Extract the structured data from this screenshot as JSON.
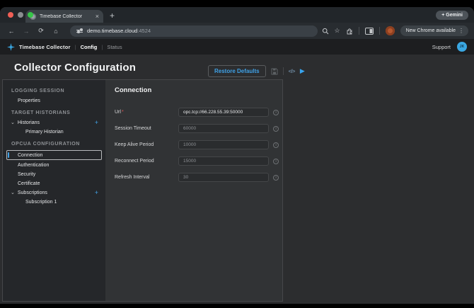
{
  "icons": {
    "back": "←",
    "forward": "→",
    "reload": "⟳",
    "home": "⌂",
    "star": "☆",
    "menu_dots": "⋮",
    "close_tab": "×",
    "new_tab": "+",
    "chevron_down": "⌄",
    "plus": "+",
    "code": "</>",
    "play": "▶",
    "info": "i"
  },
  "colors": {
    "accent_blue": "#41a3e8",
    "required_red": "#e05252",
    "user_avatar_blue": "#3aa7e2",
    "profile_avatar_orange": "#b5582f"
  },
  "browser": {
    "tab_title": "Timebase Collector",
    "gemini_button": "+ Gemini",
    "url_host": "demo.timebase.cloud",
    "url_port": ":4524",
    "new_chrome_label": "New Chrome available"
  },
  "app_header": {
    "brand": "Timebase Collector",
    "nav": [
      {
        "label": "Config",
        "active": true
      },
      {
        "label": "Status",
        "active": false
      }
    ],
    "support": "Support",
    "avatar_initials": "JK"
  },
  "page": {
    "title": "Collector Configuration",
    "restore_defaults_label": "Restore Defaults"
  },
  "sidebar": {
    "sections": [
      {
        "header": "LOGGING SESSION",
        "items": [
          {
            "label": "Properties",
            "type": "item"
          }
        ]
      },
      {
        "header": "TARGET HISTORIANS",
        "items": [
          {
            "label": "Historians",
            "type": "group",
            "expanded": true,
            "addable": true
          },
          {
            "label": "Primary Historian",
            "type": "child"
          }
        ]
      },
      {
        "header": "OPCUA CONFIGURATION",
        "items": [
          {
            "label": "Connection",
            "type": "item",
            "selected": true
          },
          {
            "label": "Authentication",
            "type": "item"
          },
          {
            "label": "Security",
            "type": "item"
          },
          {
            "label": "Certificate",
            "type": "item"
          },
          {
            "label": "Subscriptions",
            "type": "group",
            "expanded": true,
            "addable": true
          },
          {
            "label": "Subscription 1",
            "type": "child"
          }
        ]
      }
    ]
  },
  "form": {
    "title": "Connection",
    "fields": [
      {
        "label": "Url",
        "required": true,
        "value": "opc.tcp://66.228.55.39:50000",
        "muted": false
      },
      {
        "label": "Session Timeout",
        "required": false,
        "value": "60000",
        "muted": true
      },
      {
        "label": "Keep Alive Period",
        "required": false,
        "value": "10000",
        "muted": true
      },
      {
        "label": "Reconnect Period",
        "required": false,
        "value": "15000",
        "muted": true
      },
      {
        "label": "Refresh Interval",
        "required": false,
        "value": "30",
        "muted": true
      }
    ]
  }
}
